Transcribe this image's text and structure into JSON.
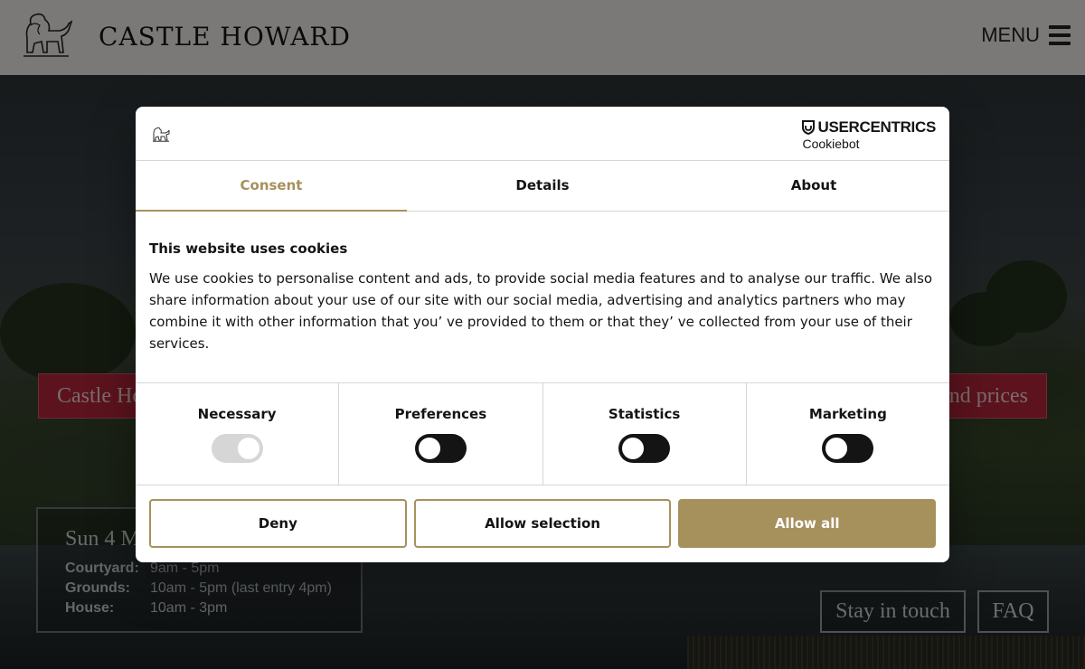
{
  "site": {
    "brand": "CASTLE HOWARD",
    "menu_label": "MENU",
    "ribbon_left": "Castle Ho",
    "ribbon_right": "nd prices",
    "hours": {
      "date": "Sun 4 M",
      "rows": [
        {
          "label": "Courtyard:",
          "value": "9am - 5pm"
        },
        {
          "label": "Grounds:",
          "value": "10am - 5pm (last entry 4pm)"
        },
        {
          "label": "House:",
          "value": "10am - 3pm"
        }
      ]
    },
    "stay_in_touch": "Stay in touch",
    "faq": "FAQ"
  },
  "cookie_dialog": {
    "vendor": {
      "name": "USERCENTRICS",
      "product": "Cookiebot"
    },
    "tabs": [
      {
        "label": "Consent",
        "active": true
      },
      {
        "label": "Details",
        "active": false
      },
      {
        "label": "About",
        "active": false
      }
    ],
    "heading": "This website uses cookies",
    "body": "We use cookies to personalise content and ads, to provide social media features and to analyse our traffic. We also share information about your use of our site with our social media, advertising and analytics partners who may combine it with other information that you’ ve provided to them or that they’ ve collected from your use of their services.",
    "categories": [
      {
        "label": "Necessary",
        "state": "disabled-on"
      },
      {
        "label": "Preferences",
        "state": "off"
      },
      {
        "label": "Statistics",
        "state": "off"
      },
      {
        "label": "Marketing",
        "state": "off"
      }
    ],
    "buttons": {
      "deny": "Deny",
      "allow_selection": "Allow selection",
      "allow_all": "Allow all"
    }
  },
  "colors": {
    "accent": "#a6915d",
    "ribbon": "#b8273a"
  }
}
